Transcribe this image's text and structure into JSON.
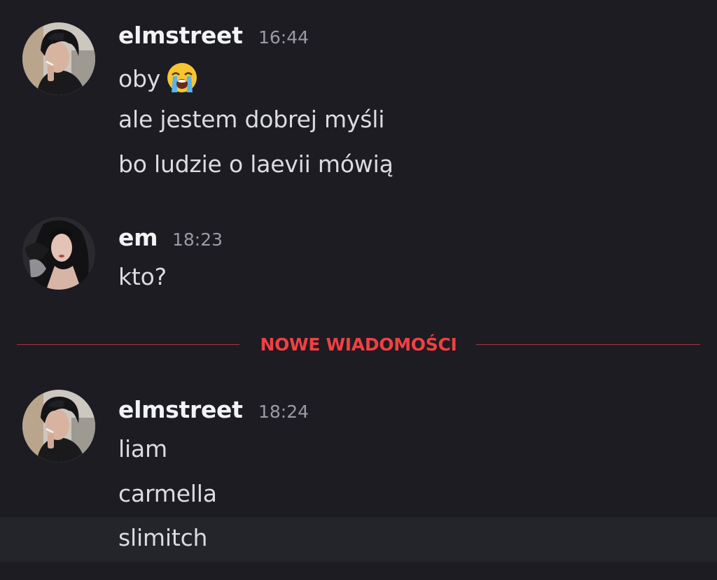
{
  "messages": [
    {
      "username": "elmstreet",
      "time": "16:44",
      "avatar": "man-smoking-avatar",
      "lines": [
        "oby",
        "ale jestem dobrej myśli",
        "bo ludzie o laevii mówią"
      ],
      "emoji": "loudly-crying-face-icon"
    },
    {
      "username": "em",
      "time": "18:23",
      "avatar": "woman-portrait-avatar",
      "lines": [
        "kto?"
      ]
    },
    {
      "username": "elmstreet",
      "time": "18:24",
      "avatar": "man-smoking-avatar",
      "lines": [
        "liam",
        "carmella",
        "slimitch"
      ]
    }
  ],
  "divider": {
    "label": "NOWE WIADOMOŚCI"
  },
  "colors": {
    "background": "#1c1c22",
    "new_messages_red": "#f23f43",
    "username": "#f2f3f5",
    "message_text": "#dbdcdf",
    "timestamp": "#9a9ba3"
  }
}
